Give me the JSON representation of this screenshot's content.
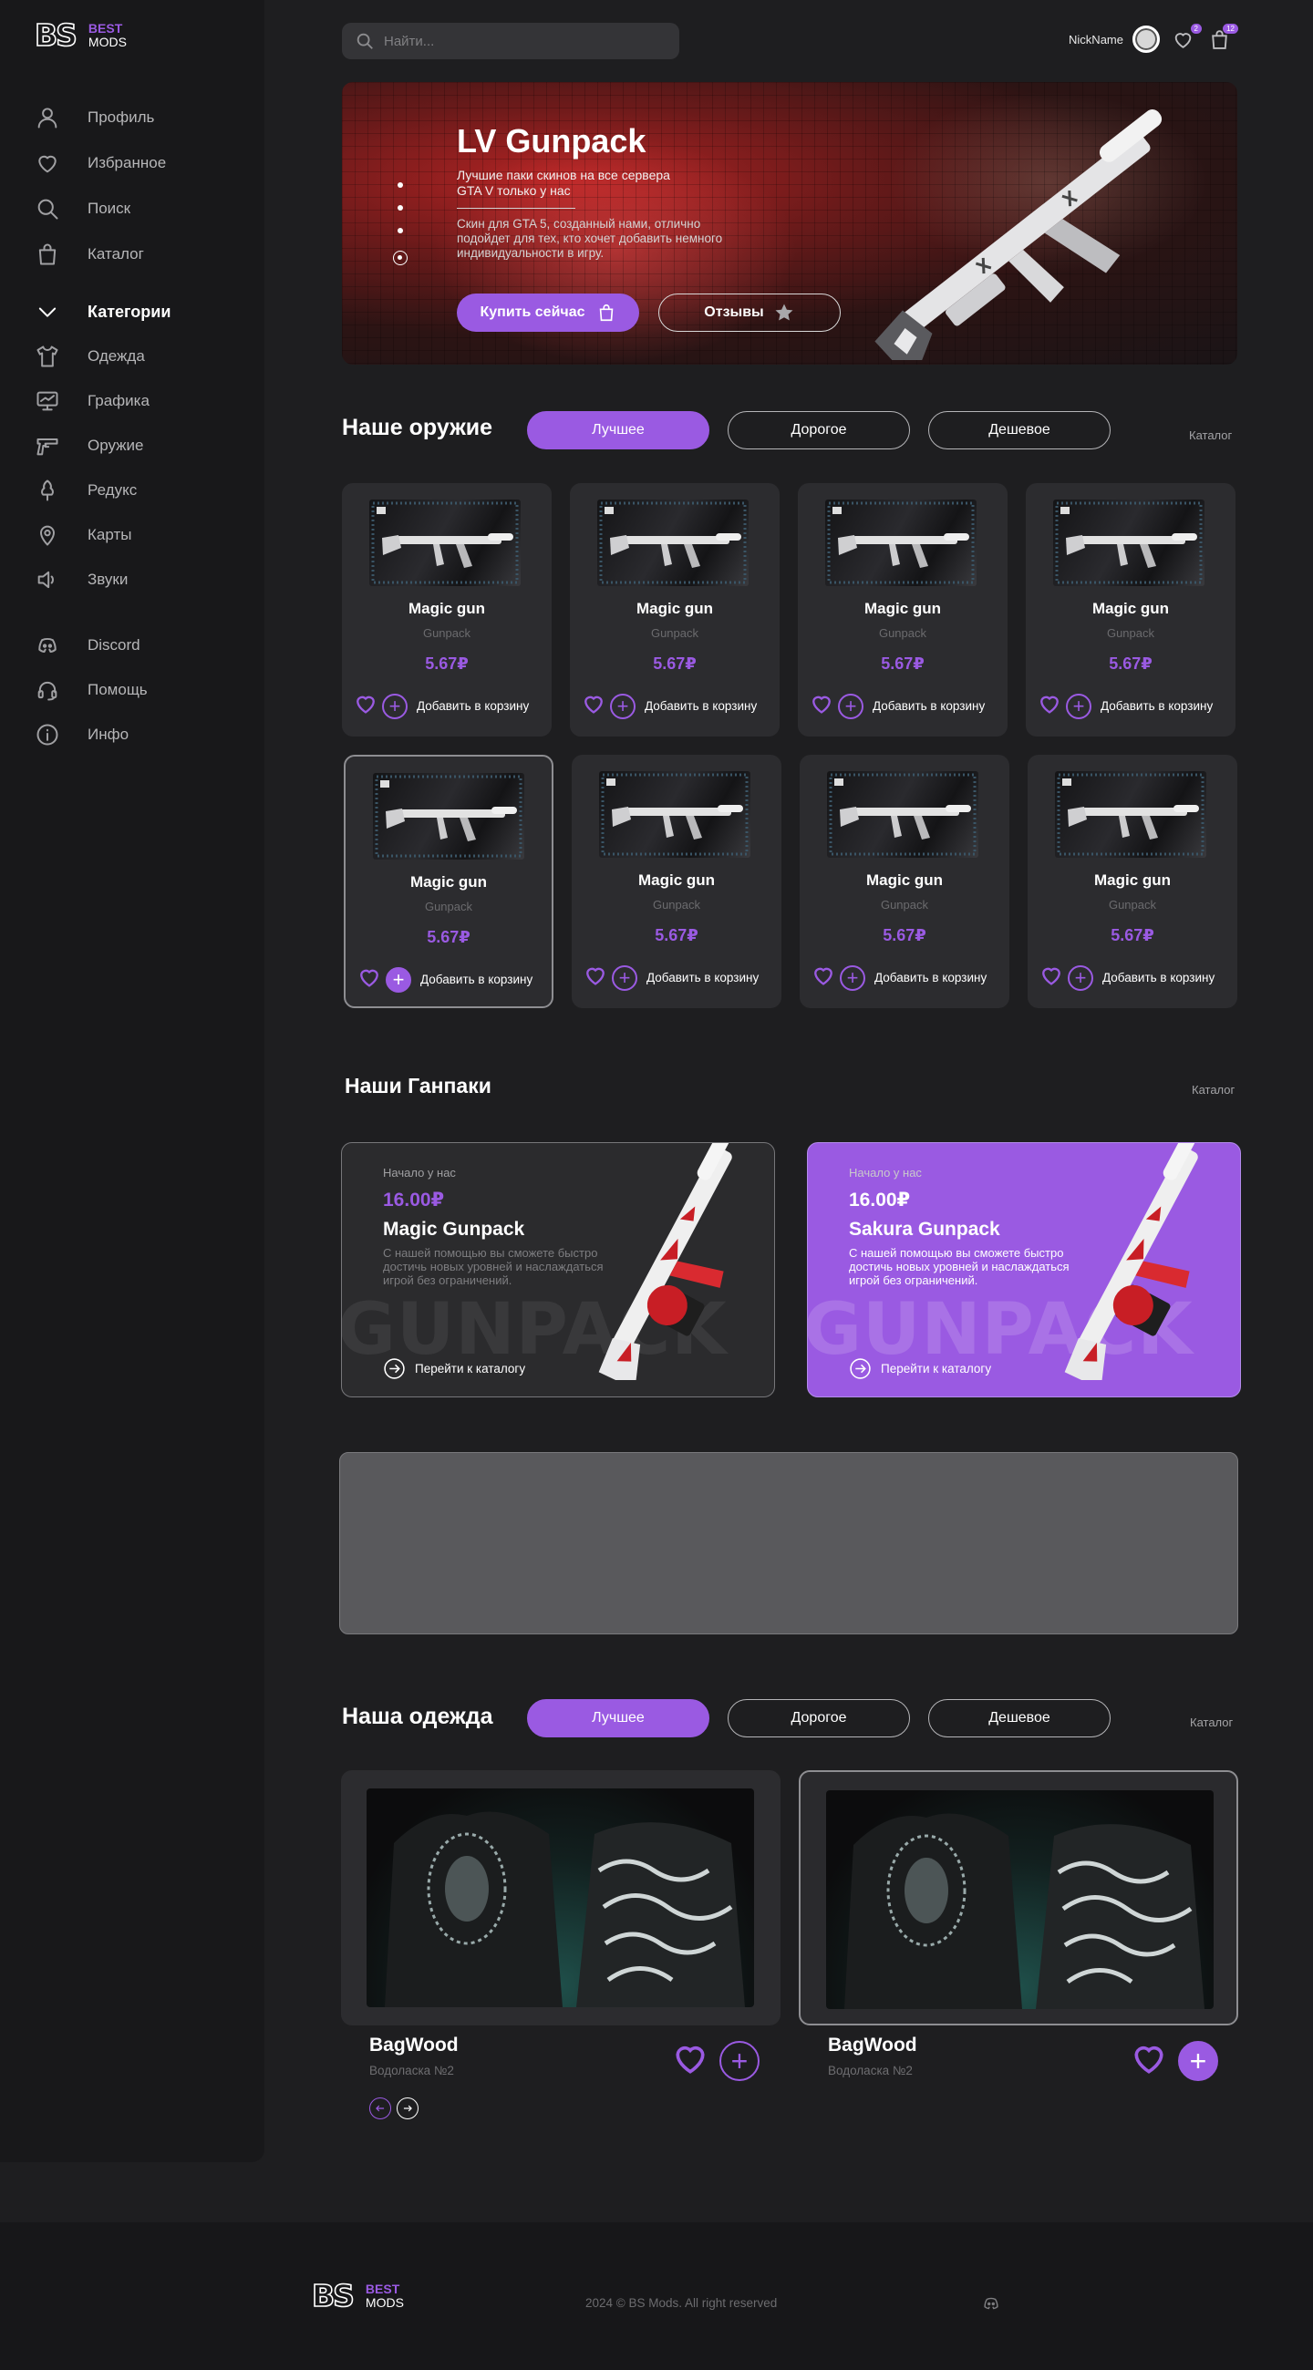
{
  "brand": {
    "mark": "BS",
    "line1": "BEST",
    "line2": "MODS"
  },
  "sidebar": {
    "items": [
      {
        "label": "Профиль",
        "icon": "user-icon"
      },
      {
        "label": "Избранное",
        "icon": "heart-icon"
      },
      {
        "label": "Поиск",
        "icon": "search-icon"
      },
      {
        "label": "Каталог",
        "icon": "bag-icon"
      }
    ],
    "categories_label": "Категории",
    "categories": [
      {
        "label": "Одежда",
        "icon": "tshirt-icon"
      },
      {
        "label": "Графика",
        "icon": "monitor-icon"
      },
      {
        "label": "Оружие",
        "icon": "gun-icon"
      },
      {
        "label": "Редукс",
        "icon": "tree-icon"
      },
      {
        "label": "Карты",
        "icon": "map-pin-icon"
      },
      {
        "label": "Звуки",
        "icon": "speaker-icon"
      }
    ],
    "extra": [
      {
        "label": "Discord",
        "icon": "discord-icon"
      },
      {
        "label": "Помощь",
        "icon": "headset-icon"
      },
      {
        "label": "Инфо",
        "icon": "info-icon"
      }
    ]
  },
  "search": {
    "placeholder": "Найти..."
  },
  "user": {
    "nick": "NickName",
    "favorites_count": "2",
    "cart_count": "12"
  },
  "hero": {
    "title": "LV Gunpack",
    "subtitle": "Лучшие паки скинов на все сервера GTA V только у нас",
    "description": "Скин для GTA 5, созданный нами, отлично подойдет для тех, кто хочет добавить немного индивидуальности в игру.",
    "buy_label": "Купить сейчас",
    "reviews_label": "Отзывы"
  },
  "weapons": {
    "title": "Наше оружие",
    "tabs": [
      "Лучшее",
      "Дорогое",
      "Дешевое"
    ],
    "catalog_label": "Каталог",
    "add_label": "Добавить в корзину",
    "items": [
      {
        "name": "Magic gun",
        "category": "Gunpack",
        "price": "5.67₽"
      },
      {
        "name": "Magic gun",
        "category": "Gunpack",
        "price": "5.67₽"
      },
      {
        "name": "Magic gun",
        "category": "Gunpack",
        "price": "5.67₽"
      },
      {
        "name": "Magic gun",
        "category": "Gunpack",
        "price": "5.67₽"
      },
      {
        "name": "Magic gun",
        "category": "Gunpack",
        "price": "5.67₽"
      },
      {
        "name": "Magic gun",
        "category": "Gunpack",
        "price": "5.67₽"
      },
      {
        "name": "Magic gun",
        "category": "Gunpack",
        "price": "5.67₽"
      },
      {
        "name": "Magic gun",
        "category": "Gunpack",
        "price": "5.67₽"
      }
    ]
  },
  "gunpacks": {
    "title": "Наши Ганпаки",
    "catalog_label": "Каталог",
    "items": [
      {
        "small": "Начало у нас",
        "price": "16.00₽",
        "name": "Magic Gunpack",
        "desc": "С нашей помощью вы сможете быстро достичь новых уровней и наслаждаться игрой без ограничений.",
        "watermark": "GUNPACK",
        "link": "Перейти к каталогу"
      },
      {
        "small": "Начало у нас",
        "price": "16.00₽",
        "name": "Sakura Gunpack",
        "desc": "С нашей помощью вы сможете быстро достичь новых уровней и наслаждаться игрой без ограничений.",
        "watermark": "GUNPACK",
        "link": "Перейти к каталогу"
      }
    ]
  },
  "clothes": {
    "title": "Наша одежда",
    "tabs": [
      "Лучшее",
      "Дорогое",
      "Дешевое"
    ],
    "catalog_label": "Каталог",
    "items": [
      {
        "name": "BagWood",
        "sub": "Водоласка №2"
      },
      {
        "name": "BagWood",
        "sub": "Водоласка №2"
      }
    ]
  },
  "footer": {
    "copyright": "2024 © BS Mods. All right reserved"
  },
  "colors": {
    "accent": "#9a5ae2",
    "background": "#1e1e20",
    "sidebar": "#18181a",
    "card": "#2c2c2f"
  }
}
